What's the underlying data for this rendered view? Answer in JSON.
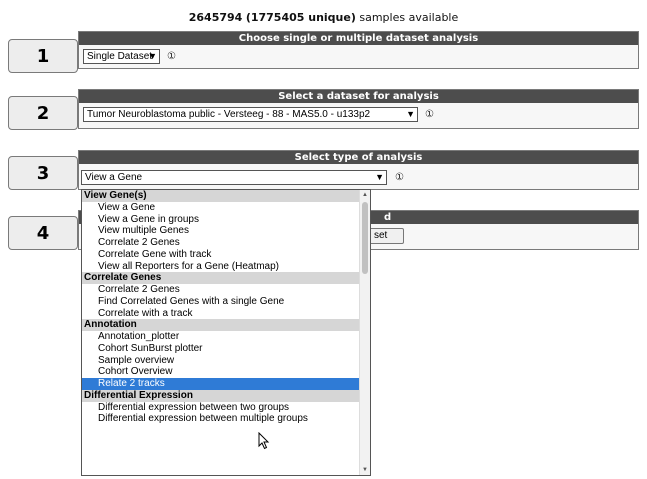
{
  "header": {
    "count": "2645794",
    "unique": "(1775405 unique)",
    "suffix": "samples available"
  },
  "steps": [
    {
      "number": "1",
      "title": "Choose single or multiple dataset analysis",
      "select_value": "Single Dataset",
      "info": "①"
    },
    {
      "number": "2",
      "title": "Select a dataset for analysis",
      "select_value": "Tumor Neuroblastoma public - Versteeg - 88 - MAS5.0 - u133p2",
      "info": "①"
    },
    {
      "number": "3",
      "title": "Select type of analysis",
      "select_value": "View a Gene",
      "info": "①"
    },
    {
      "number": "4",
      "title": "d",
      "button_label": "set"
    }
  ],
  "dropdown": {
    "items": [
      {
        "label": "View Gene(s)",
        "group": true
      },
      {
        "label": "View a Gene"
      },
      {
        "label": "View a Gene in groups"
      },
      {
        "label": "View multiple Genes"
      },
      {
        "label": "Correlate 2 Genes"
      },
      {
        "label": "Correlate Gene with track"
      },
      {
        "label": "View all Reporters for a Gene (Heatmap)"
      },
      {
        "label": "Correlate Genes",
        "group": true
      },
      {
        "label": "Correlate 2 Genes"
      },
      {
        "label": "Find Correlated Genes with a single Gene"
      },
      {
        "label": "Correlate with a track"
      },
      {
        "label": "Annotation",
        "group": true
      },
      {
        "label": "Annotation_plotter"
      },
      {
        "label": "Cohort SunBurst plotter"
      },
      {
        "label": "Sample overview"
      },
      {
        "label": "Cohort Overview"
      },
      {
        "label": "Relate 2 tracks",
        "selected": true
      },
      {
        "label": "Differential Expression",
        "group": true
      },
      {
        "label": "Differential expression between two groups"
      },
      {
        "label": "Differential expression between multiple groups"
      }
    ]
  }
}
